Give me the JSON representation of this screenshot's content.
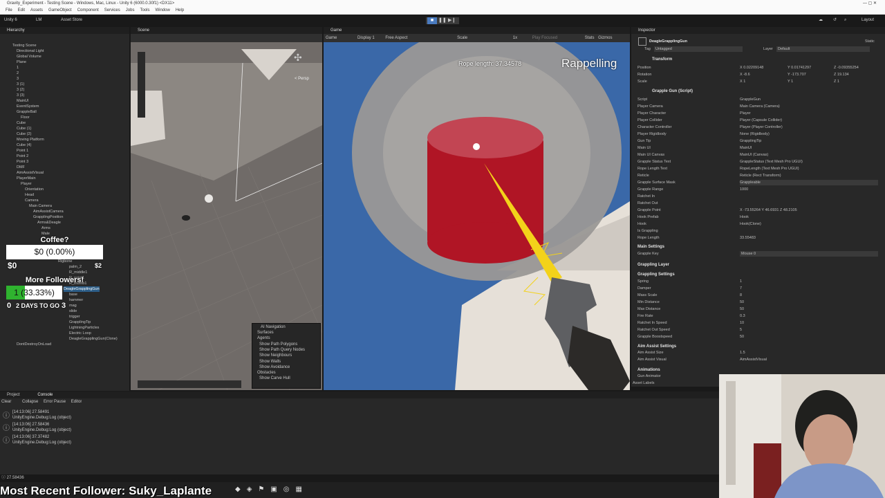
{
  "titlebar": {
    "title": "Gravity_Experiment - Testing Scene - Windows, Mac, Linux - Unity 6 (6000.0.30f1) <DX11>"
  },
  "menu": [
    "File",
    "Edit",
    "Assets",
    "GameObject",
    "Component",
    "Services",
    "Jobs",
    "Tools",
    "Window",
    "Help"
  ],
  "toolbar": {
    "account": "Unity 6",
    "user": "LM",
    "asset_store": "Asset Store",
    "layout": "Layout"
  },
  "hierarchy": {
    "tab": "Hierarchy",
    "items": [
      "Testing Scene",
      "Directional Light",
      "Global Volume",
      "Plane",
      "1",
      "2",
      "3",
      "3 (1)",
      "3 (2)",
      "3 (3)",
      "MainUI",
      "EventSystem",
      "GrappleBall",
      "Floor",
      "Cube",
      "Cube (1)",
      "Cube (2)",
      "Moving Platform",
      "Cube (4)",
      "Point 1",
      "Point 2",
      "Point 3",
      "DMF",
      "AimAssistVisual",
      "PlayerMain",
      "Player",
      "Orientation",
      "Head",
      "Camera",
      "Main Camera",
      "AimAssistCamera",
      "GrapplingPosition",
      "Arms&Deagle",
      "Arms",
      "Male"
    ],
    "items2": [
      "Rigbone",
      "palm_2",
      "R_middle1",
      "R_point1",
      "R_thumb1",
      "DeagleGrapplingGun",
      "base",
      "hammer",
      "mag",
      "slide",
      "trigger",
      "GrapplingTip",
      "LightningParticles",
      "Electric Loop",
      "DeagleGrapplingGun(Clone)",
      "DontDestroyOnLoad"
    ]
  },
  "scene": {
    "tab": "Scene",
    "persp": "< Persp",
    "overlay_title": "AI Navigation",
    "overlay_items": [
      "Surfaces",
      "Agents",
      "Show Path Polygons",
      "Show Path Query Nodes",
      "Show Neighbours",
      "Show Walls",
      "Show Avoidance",
      "Obstacles",
      "Show Carve Hull"
    ]
  },
  "game": {
    "tab": "Game",
    "display": "Display 1",
    "aspect": "Free Aspect",
    "scale": "Scale",
    "scale_val": "1x",
    "play_focused": "Play Focused",
    "stats": "Stats",
    "gizmos": "Gizmos",
    "rope_length": "Rope length: 37.34578",
    "state": "Rappelling"
  },
  "stream": {
    "coffee": "Coffee?",
    "coffee_bar": "$0 (0.00%)",
    "coffee_left": "$0",
    "coffee_right": "$2",
    "followers": "More Followers!",
    "followers_bar": "1 (33.33%)",
    "followers_left": "0",
    "followers_days": "2 DAYS TO GO",
    "followers_right": "3",
    "followers_fill": 0.3333,
    "recent": "Most Recent Follower: Suky_Laplante"
  },
  "inspector": {
    "tab": "Inspector",
    "object": "DeagleGrapplingGun",
    "static": "Static",
    "tag_label": "Tag",
    "tag": "Untagged",
    "layer_label": "Layer",
    "layer": "Default",
    "transform": "Transform",
    "pos": [
      "X 0.02209148",
      "Y 0.01741297",
      "Z -0.09355254"
    ],
    "rot": [
      "X -8.6",
      "Y -173.707",
      "Z 19.134"
    ],
    "scale": [
      "X 1",
      "Y 1",
      "Z 1"
    ],
    "script": "Grapple Gun (Script)",
    "fields": [
      [
        "Script",
        "GrappleGun"
      ],
      [
        "Player Camera",
        "Main Camera (Camera)"
      ],
      [
        "Player Character",
        "Player"
      ],
      [
        "Player Collider",
        "Player (Capsule Collider)"
      ],
      [
        "Character Controller",
        "Player (Player Controller)"
      ],
      [
        "Player Rigidbody",
        "None (Rigidbody)"
      ],
      [
        "Gun Tip",
        "GrapplingTip"
      ],
      [
        "Main UI",
        "MainUI"
      ],
      [
        "Main UI Canvas",
        "MainUI (Canvas)"
      ],
      [
        "Grapple Status Text",
        "GrappleStatus (Text Mesh Pro UGUI)"
      ],
      [
        "Rope Length Text",
        "RopeLength (Text Mesh Pro UGUI)"
      ],
      [
        "Reticle",
        "Reticle (Rect Transform)"
      ],
      [
        "Grapple Surface Mask",
        "Grappleable"
      ],
      [
        "Grapple Range",
        "1000"
      ],
      [
        "Ratchet In",
        ""
      ],
      [
        "Ratchet Out",
        ""
      ],
      [
        "Grapple Point",
        "X -73.55264   Y 46.6931   Z 48.2105"
      ],
      [
        "Hook Prefab",
        "Hook"
      ],
      [
        "Hook",
        "Hook(Clone)"
      ],
      [
        "Is Grappling",
        ""
      ],
      [
        "Rope Length",
        "33.55483"
      ]
    ],
    "main_settings": "Main Settings",
    "grapple_key_label": "Grapple Key",
    "grapple_key": "Mouse 0",
    "grappling_layer": "Grappling Layer",
    "grappling_settings": "Grappling Settings",
    "gfields": [
      [
        "Spring",
        "1"
      ],
      [
        "Damper",
        "7"
      ],
      [
        "Mass Scale",
        "8"
      ],
      [
        "Min Distance",
        "50"
      ],
      [
        "Max Distance",
        "50"
      ],
      [
        "Fire Rate",
        "0.3"
      ],
      [
        "Ratchet In Speed",
        "10"
      ],
      [
        "Ratchet Out Speed",
        "5"
      ],
      [
        "Grapple Boostspeed",
        "50"
      ]
    ],
    "aim_settings": "Aim Assist Settings",
    "aim_size_label": "Aim Assist Size",
    "aim_size": "1.5",
    "aim_visual_label": "Aim Assist Visual",
    "aim_visual": "AimAssistVisual",
    "animations": "Animations",
    "gun_animator": "Gun Animator",
    "asset_labels": "Asset Labels"
  },
  "console": {
    "tab_project": "Project",
    "tab_console": "Console",
    "clear": "Clear",
    "collapse": "Collapse",
    "error_pause": "Error Pause",
    "editor": "Editor",
    "logs": [
      [
        "[14:13:06] 27.58491",
        "UnityEngine.Debug:Log (object)"
      ],
      [
        "[14:13:06] 27.58436",
        "UnityEngine.Debug:Log (object)"
      ],
      [
        "[14:13:06] 37.37482",
        "UnityEngine.Debug:Log (object)"
      ]
    ],
    "status": "27.58436"
  },
  "colors": {
    "accent": "#3a68a8",
    "bar_fill": "#2fb32f",
    "cylinder": "#b01525",
    "beam": "#f3d21a"
  }
}
